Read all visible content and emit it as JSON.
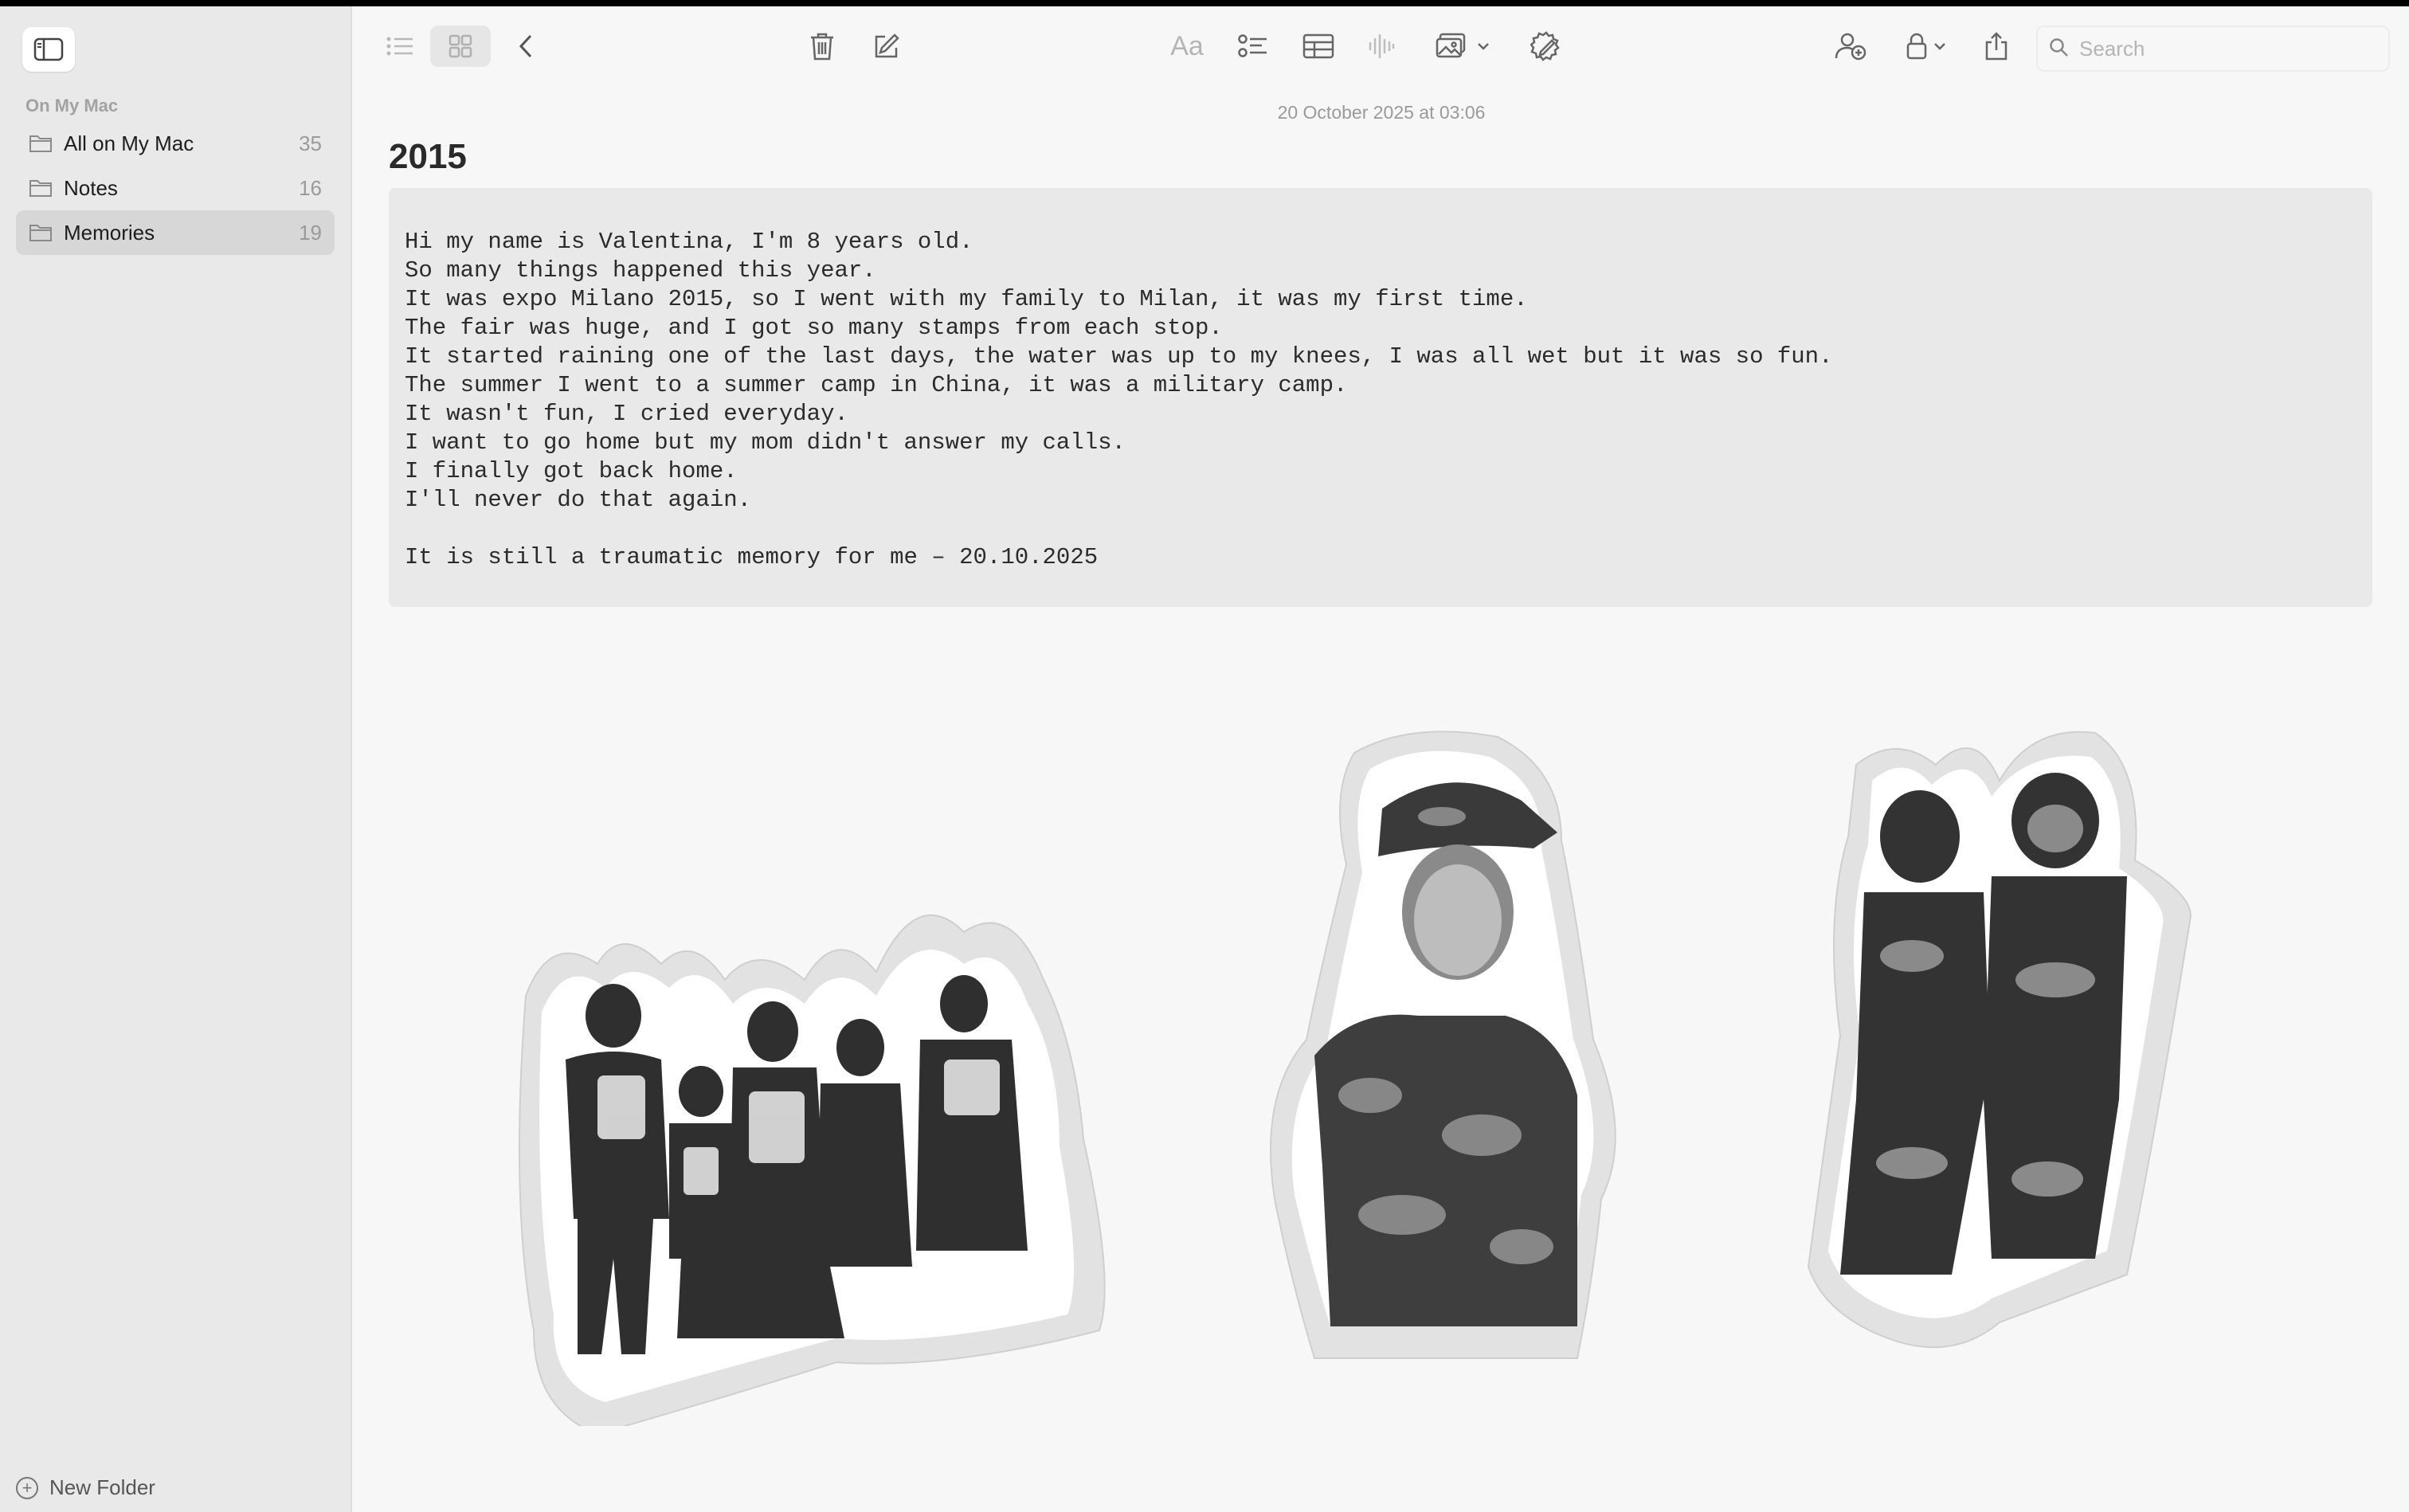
{
  "sidebar": {
    "section_title": "On My Mac",
    "folders": [
      {
        "name": "All on My Mac",
        "count": "35"
      },
      {
        "name": "Notes",
        "count": "16"
      },
      {
        "name": "Memories",
        "count": "19"
      }
    ],
    "selected_folder": "Memories",
    "new_folder_label": "New Folder"
  },
  "toolbar": {
    "format_label": "Aa",
    "search_placeholder": "Search",
    "icons": [
      "list-view-icon",
      "gallery-view-icon",
      "back-icon",
      "trash-icon",
      "compose-icon",
      "format-icon",
      "checklist-icon",
      "table-icon",
      "audio-icon",
      "media-icon",
      "markup-icon",
      "collaborate-icon",
      "lock-icon",
      "share-icon",
      "search-icon"
    ]
  },
  "note": {
    "date": "20 October 2025 at 03:06",
    "title": "2015",
    "body": "Hi my name is Valentina, I'm 8 years old.\nSo many things happened this year.\nIt was expo Milano 2015, so I went with my family to Milan, it was my first time.\nThe fair was huge, and I got so many stamps from each stop.\nIt started raining one of the last days, the water was up to my knees, I was all wet but it was so fun.\nThe summer I went to a summer camp in China, it was a military camp.\nIt wasn't fun, I cried everyday.\nI want to go home but my mom didn't answer my calls.\nI finally got back home.\nI'll never do that again.\n\nIt is still a traumatic memory for me – 20.10.2025"
  },
  "colors": {
    "sidebar_bg": "#e9e9e9",
    "selected_bg": "#d7d7d7",
    "code_bg": "#e9e9e9",
    "page_bg": "#f7f7f7"
  }
}
